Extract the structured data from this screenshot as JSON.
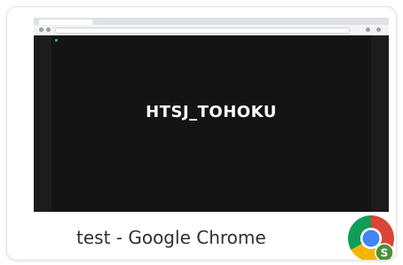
{
  "window": {
    "title": "test - Google Chrome",
    "thumbnail_text": "HTSJ_TOHOKU"
  },
  "app_icon": {
    "name": "chrome-icon",
    "profile_badge": "S",
    "colors": {
      "red": "#db4437",
      "yellow": "#f4b400",
      "green": "#0f9d58",
      "blue": "#4285f4",
      "badge": "#4a8f3a"
    }
  }
}
